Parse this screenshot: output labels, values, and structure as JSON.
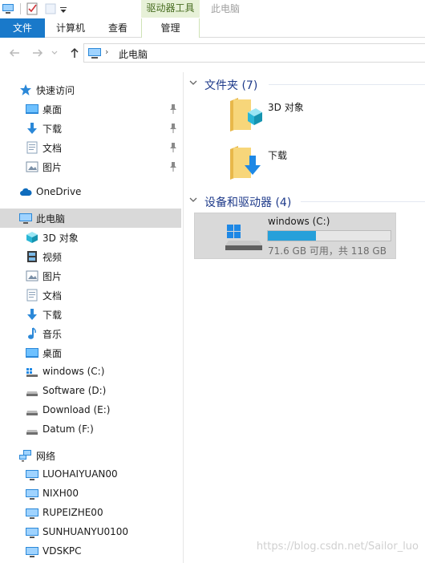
{
  "window": {
    "context_tab": "驱动器工具",
    "title": "此电脑"
  },
  "ribbon": {
    "tabs": [
      {
        "label": "文件"
      },
      {
        "label": "计算机"
      },
      {
        "label": "查看"
      },
      {
        "label": "管理"
      }
    ]
  },
  "address": {
    "path": "此电脑"
  },
  "nav_pane": {
    "quick_access": {
      "label": "快速访问",
      "items": [
        {
          "label": "桌面",
          "icon": "desktop-icon",
          "pinned": true
        },
        {
          "label": "下载",
          "icon": "download-icon",
          "pinned": true
        },
        {
          "label": "文档",
          "icon": "document-icon",
          "pinned": true
        },
        {
          "label": "图片",
          "icon": "picture-icon",
          "pinned": true
        }
      ]
    },
    "onedrive": {
      "label": "OneDrive",
      "icon": "cloud-icon"
    },
    "this_pc": {
      "label": "此电脑",
      "icon": "computer-icon",
      "items": [
        {
          "label": "3D 对象",
          "icon": "3d-objects-icon"
        },
        {
          "label": "视频",
          "icon": "video-icon"
        },
        {
          "label": "图片",
          "icon": "picture-icon"
        },
        {
          "label": "文档",
          "icon": "document-icon"
        },
        {
          "label": "下载",
          "icon": "download-icon"
        },
        {
          "label": "音乐",
          "icon": "music-icon"
        },
        {
          "label": "桌面",
          "icon": "desktop-icon"
        },
        {
          "label": "windows (C:)",
          "icon": "windows-drive-icon"
        },
        {
          "label": "Software (D:)",
          "icon": "drive-icon"
        },
        {
          "label": "Download (E:)",
          "icon": "drive-icon"
        },
        {
          "label": "Datum (F:)",
          "icon": "drive-icon"
        }
      ]
    },
    "network": {
      "label": "网络",
      "icon": "network-icon",
      "items": [
        {
          "label": "LUOHAIYUAN00",
          "icon": "computer-icon"
        },
        {
          "label": "NIXH00",
          "icon": "computer-icon"
        },
        {
          "label": "RUPEIZHE00",
          "icon": "computer-icon"
        },
        {
          "label": "SUNHUANYU0100",
          "icon": "computer-icon"
        },
        {
          "label": "VDSKPC",
          "icon": "computer-icon"
        }
      ]
    }
  },
  "content": {
    "folders_group": {
      "title": "文件夹 (7)",
      "items": [
        {
          "label": "3D 对象",
          "icon": "3d-objects-folder-icon"
        },
        {
          "label": "下载",
          "icon": "download-folder-icon"
        }
      ]
    },
    "drives_group": {
      "title": "设备和驱动器 (4)",
      "drive": {
        "name": "windows (C:)",
        "free_text": "71.6 GB 可用，共 118 GB",
        "used_fraction": 0.393,
        "bar_color": "#26a0da"
      }
    }
  },
  "watermark": "https://blog.csdn.net/Sailor_luo",
  "colors": {
    "file_tab": "#1979ca",
    "context_tab_bg": "#e7f1d8",
    "context_tab_text": "#486d21",
    "selected_bg": "#d9d9d9",
    "group_title": "#1e3a8a"
  }
}
